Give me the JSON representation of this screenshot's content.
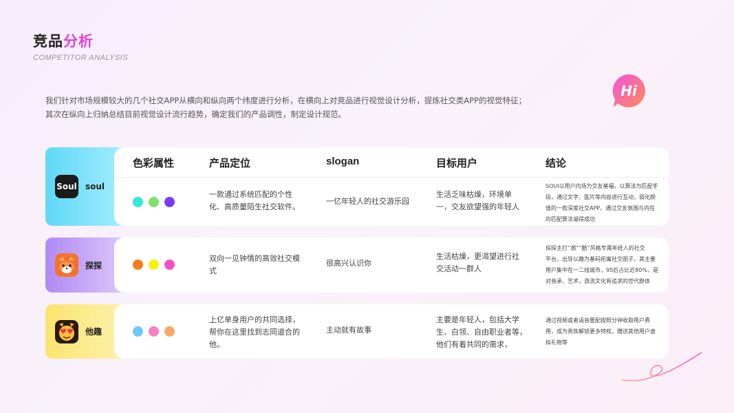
{
  "header": {
    "title_part1": "竞品",
    "title_part2": "分析",
    "subtitle": "COMPETITOR ANALYSIS"
  },
  "intro": {
    "line1": "我们针对市场规模较大的几个社交APP从横向和纵向两个纬度进行分析，在横向上对竞品进行视觉设计分析，提炼社交类APP的视觉特征；",
    "line2": "其次在纵向上归纳总结目前视觉设计流行趋势，确定我们的产品调性，制定设计规范。"
  },
  "logo": {
    "text": "Hi"
  },
  "columns": [
    "色彩属性",
    "产品定位",
    "slogan",
    "目标用户",
    "结论"
  ],
  "apps": [
    {
      "name": "soul",
      "icon_text": "Soul",
      "brand_gradient": [
        "#5fd8f8",
        "#a6eefc"
      ],
      "colors": [
        "#32e8d8",
        "#7be36a",
        "#7a3cf0"
      ],
      "positioning": [
        "一款通过系统匹配的个性",
        "化、高质量陌生社交软件。"
      ],
      "slogan": "一亿年轻人的社交游乐园",
      "target": [
        "生活乏味枯燥，环境单",
        "一，交友欲望强的年轻人"
      ],
      "conclusion": [
        "SOUl以用户内场为交友基福，以算法为匹配手",
        "段，通过文字、医片等内容进行互动，弱化颜",
        "值的一款深度社交APP。通过交友氛围与内在",
        "的匹配算法凝得成功"
      ]
    },
    {
      "name": "探探",
      "icon_text": "",
      "brand_gradient": [
        "#b08af5",
        "#ddc9fb"
      ],
      "colors": [
        "#f97a1b",
        "#f6f00a",
        "#f54fc7"
      ],
      "positioning": [
        "双向一见钟情的高效社交模",
        "式"
      ],
      "slogan": "很高兴认识你",
      "target": [
        "生活枯燥，更渴望进行社",
        "交活动一群人"
      ],
      "conclusion": [
        "探探主打“潮”“酷”风格专属年经人的社交",
        "平台，出导以趣为基码拓寓社交图子，其主要",
        "用户集中在一二线城市，95后占比近80%，是",
        "对音承、艺术，游流文化有追求的世代群体"
      ]
    },
    {
      "name": "他趣",
      "icon_text": "",
      "brand_gradient": [
        "#fbe46e",
        "#fdf2b0"
      ],
      "colors": [
        "#6cc8f6",
        "#f77fc4",
        "#f7a96c"
      ],
      "positioning": [
        "上亿单身用户的共同选择，",
        "帮你在这里找到志同道合的",
        "他。"
      ],
      "slogan": "主动就有故事",
      "target": [
        "主要是年轻人，包括大学",
        "生、白领、自由职业者等，",
        "他们有着共同的需求，"
      ],
      "conclusion": [
        "通过视频或者语音匿配按照分钟收取用户费",
        "用，成为贵族解锁更多特权，赠送其他用户虚",
        "拟礼物等"
      ]
    }
  ]
}
